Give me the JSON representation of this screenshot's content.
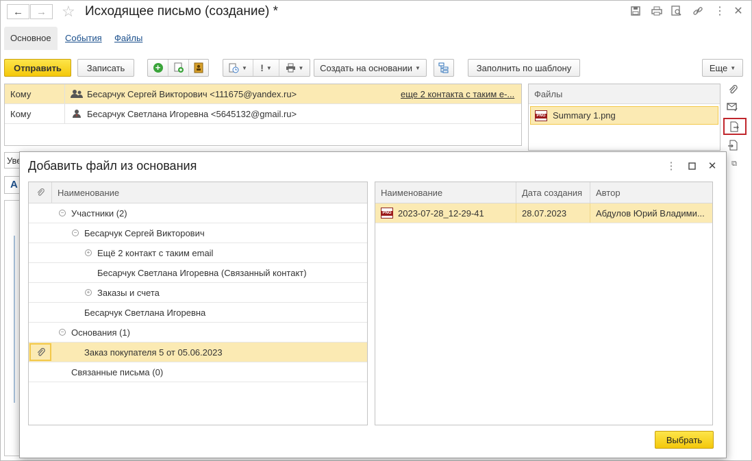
{
  "window": {
    "title": "Исходящее письмо  (создание) *",
    "icons": [
      "back-arrow-icon",
      "forward-arrow-icon",
      "star-icon",
      "save-icon",
      "print-icon",
      "preview-icon",
      "link-icon",
      "more-icon",
      "close-icon"
    ]
  },
  "tabs": [
    {
      "label": "Основное"
    },
    {
      "label": "События"
    },
    {
      "label": "Файлы"
    }
  ],
  "toolbar": {
    "send_label": "Отправить",
    "write_label": "Записать",
    "create_based_label": "Создать на основании",
    "fill_template_label": "Заполнить по шаблону",
    "more_label": "Еще"
  },
  "recipients": [
    {
      "kind": "Кому",
      "name": "Бесарчук Сергей Викторович <111675@yandex.ru>",
      "note": "еще 2 контакта с таким е-..."
    },
    {
      "kind": "Кому",
      "name": "Бесарчук Светлана Игоревна <5645132@gmail.ru>",
      "note": ""
    }
  ],
  "files_panel": {
    "header": "Файлы",
    "items": [
      {
        "name": "Summary 1.png"
      }
    ]
  },
  "bg_fragments": {
    "combo_prefix": "Уве",
    "letter": "А"
  },
  "dialog": {
    "title": "Добавить файл из основания",
    "left_header": "Наименование",
    "tree": [
      {
        "label": "Участники (2)",
        "toggle": "⊖"
      },
      {
        "label": "Бесарчук Сергей Викторович",
        "toggle": "⊖"
      },
      {
        "label": "Ещё 2 контакт с таким email",
        "toggle": "⊕"
      },
      {
        "label": "Бесарчук Светлана Игоревна (Связанный контакт)",
        "toggle": ""
      },
      {
        "label": "Заказы и счета",
        "toggle": "⊕"
      },
      {
        "label": "Бесарчук Светлана Игоревна",
        "toggle": ""
      },
      {
        "label": "Основания (1)",
        "toggle": "⊖"
      },
      {
        "label": "Заказ покупателя 5 от 05.06.2023",
        "toggle": ""
      },
      {
        "label": "Связанные письма (0)",
        "toggle": ""
      }
    ],
    "right_headers": {
      "name": "Наименование",
      "date": "Дата создания",
      "author": "Автор"
    },
    "files": [
      {
        "name": "2023-07-28_12-29-41",
        "date": "28.07.2023",
        "author": "Абдулов Юрий Владими..."
      }
    ],
    "select_label": "Выбрать"
  }
}
